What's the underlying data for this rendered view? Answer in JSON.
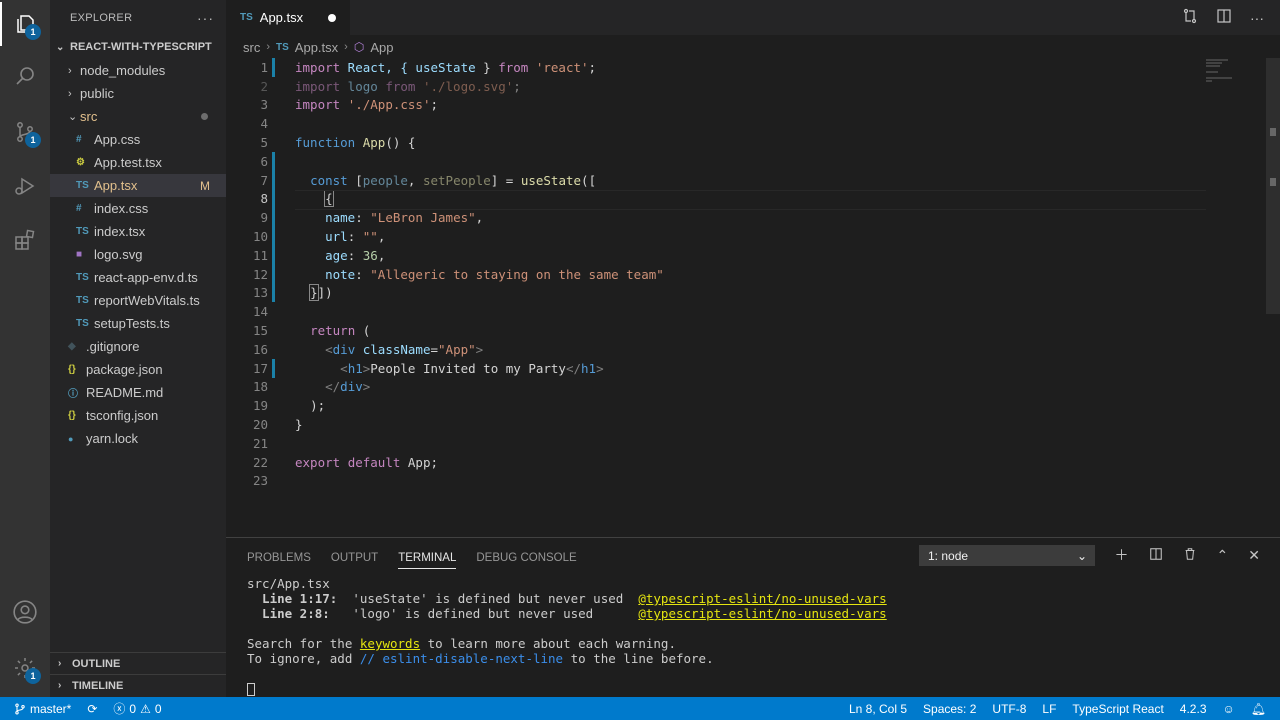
{
  "activity_bar": {
    "explorer_badge": "1",
    "source_control_badge": "1",
    "settings_badge": "1"
  },
  "sidebar": {
    "title": "EXPLORER",
    "more_label": "···",
    "project": "REACT-WITH-TYPESCRIPT",
    "items": [
      {
        "label": "node_modules"
      },
      {
        "label": "public"
      },
      {
        "label": "src"
      },
      {
        "label": "App.css",
        "icon": "#"
      },
      {
        "label": "App.test.tsx",
        "icon": "⚙"
      },
      {
        "label": "App.tsx",
        "icon": "TS",
        "mark": "M"
      },
      {
        "label": "index.css",
        "icon": "#"
      },
      {
        "label": "index.tsx",
        "icon": "TS"
      },
      {
        "label": "logo.svg",
        "icon": "■"
      },
      {
        "label": "react-app-env.d.ts",
        "icon": "TS"
      },
      {
        "label": "reportWebVitals.ts",
        "icon": "TS"
      },
      {
        "label": "setupTests.ts",
        "icon": "TS"
      },
      {
        "label": ".gitignore",
        "icon": "◆"
      },
      {
        "label": "package.json",
        "icon": "{}"
      },
      {
        "label": "README.md",
        "icon": "ⓘ"
      },
      {
        "label": "tsconfig.json",
        "icon": "{}"
      },
      {
        "label": "yarn.lock",
        "icon": "🧶"
      }
    ],
    "outline": "OUTLINE",
    "timeline": "TIMELINE"
  },
  "tab": {
    "icon": "TS",
    "label": "App.tsx"
  },
  "breadcrumb": {
    "folder": "src",
    "file_icon": "TS",
    "file": "App.tsx",
    "symbol": "App"
  },
  "code_lines": [
    "1",
    "2",
    "3",
    "4",
    "5",
    "6",
    "7",
    "8",
    "9",
    "10",
    "11",
    "12",
    "13",
    "14",
    "15",
    "16",
    "17",
    "18",
    "19",
    "20",
    "21",
    "22",
    "23"
  ],
  "code": {
    "l1": [
      "import",
      " React, { ",
      "useState",
      " } ",
      "from",
      " ",
      "'react'",
      ";"
    ],
    "l2": [
      "import",
      " logo ",
      "from",
      " ",
      "'./logo.svg'",
      ";"
    ],
    "l3": [
      "import",
      " ",
      "'./App.css'",
      ";"
    ],
    "l5": [
      "function",
      " ",
      "App",
      "() {"
    ],
    "l7": [
      "const",
      " [",
      "people",
      ", ",
      "setPeople",
      "] = ",
      "useState",
      "(["
    ],
    "l8": "{",
    "l9": [
      "name",
      ": ",
      "\"LeBron James\"",
      ","
    ],
    "l10": [
      "url",
      ": ",
      "\"\"",
      ","
    ],
    "l11": [
      "age",
      ": ",
      "36",
      ","
    ],
    "l12": [
      "note",
      ": ",
      "\"Allegeric to staying on the same team\""
    ],
    "l13": [
      "}",
      "])"
    ],
    "l15": [
      "return",
      " ("
    ],
    "l16": [
      "<",
      "div",
      " ",
      "className",
      "=",
      "\"App\"",
      ">"
    ],
    "l17": [
      "<",
      "h1",
      ">",
      "People Invited to my Party",
      "</",
      "h1",
      ">"
    ],
    "l18": [
      "</",
      "div",
      ">"
    ],
    "l19": ");",
    "l20": "}",
    "l22": [
      "export",
      " ",
      "default",
      " App;"
    ]
  },
  "panel": {
    "tabs": [
      "PROBLEMS",
      "OUTPUT",
      "TERMINAL",
      "DEBUG CONSOLE"
    ],
    "terminal_select": "1: node",
    "terminal": {
      "file": "src/App.tsx",
      "w1_loc": "  Line 1:17:",
      "w1_msg": "  'useState' is defined but never used  ",
      "w1_rule": "@typescript-eslint/no-unused-vars",
      "w2_loc": "  Line 2:8:",
      "w2_msg": "   'logo' is defined but never used      ",
      "w2_rule": "@typescript-eslint/no-unused-vars",
      "search_pre": "Search for the ",
      "search_kw": "keywords",
      "search_post": " to learn more about each warning.",
      "ignore_pre": "To ignore, add ",
      "ignore_kw": "// eslint-disable-next-line",
      "ignore_post": " to the line before."
    }
  },
  "status": {
    "branch": "master*",
    "errors": "0",
    "warnings": "0",
    "position": "Ln 8, Col 5",
    "spaces": "Spaces: 2",
    "encoding": "UTF-8",
    "eol": "LF",
    "language": "TypeScript React",
    "version": "4.2.3"
  },
  "colors": {
    "status_bar": "#007acc",
    "editor_bg": "#1e1e1e",
    "sidebar_bg": "#252526",
    "activity_bg": "#333333"
  }
}
